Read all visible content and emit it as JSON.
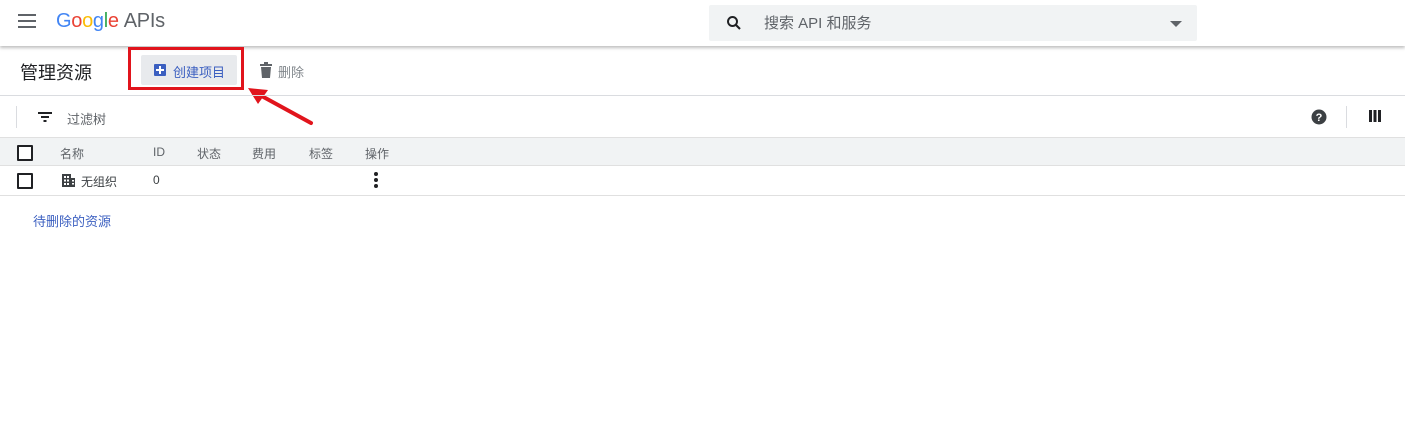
{
  "header": {
    "logo": {
      "g1": "G",
      "g2": "o",
      "g3": "o",
      "g4": "g",
      "g5": "l",
      "g6": "e",
      "product": "APIs"
    },
    "search_placeholder": "搜索 API 和服务"
  },
  "toolbar": {
    "title": "管理资源",
    "create_label": "创建项目",
    "delete_label": "删除"
  },
  "filter": {
    "label": "过滤树"
  },
  "table": {
    "columns": [
      "名称",
      "ID",
      "状态",
      "费用",
      "标签",
      "操作"
    ],
    "rows": [
      {
        "name": "无组织",
        "id": "0"
      }
    ]
  },
  "links": {
    "pending_delete": "待删除的资源"
  },
  "colors": {
    "accent": "#3b5fc0",
    "highlight": "#e1141c"
  }
}
